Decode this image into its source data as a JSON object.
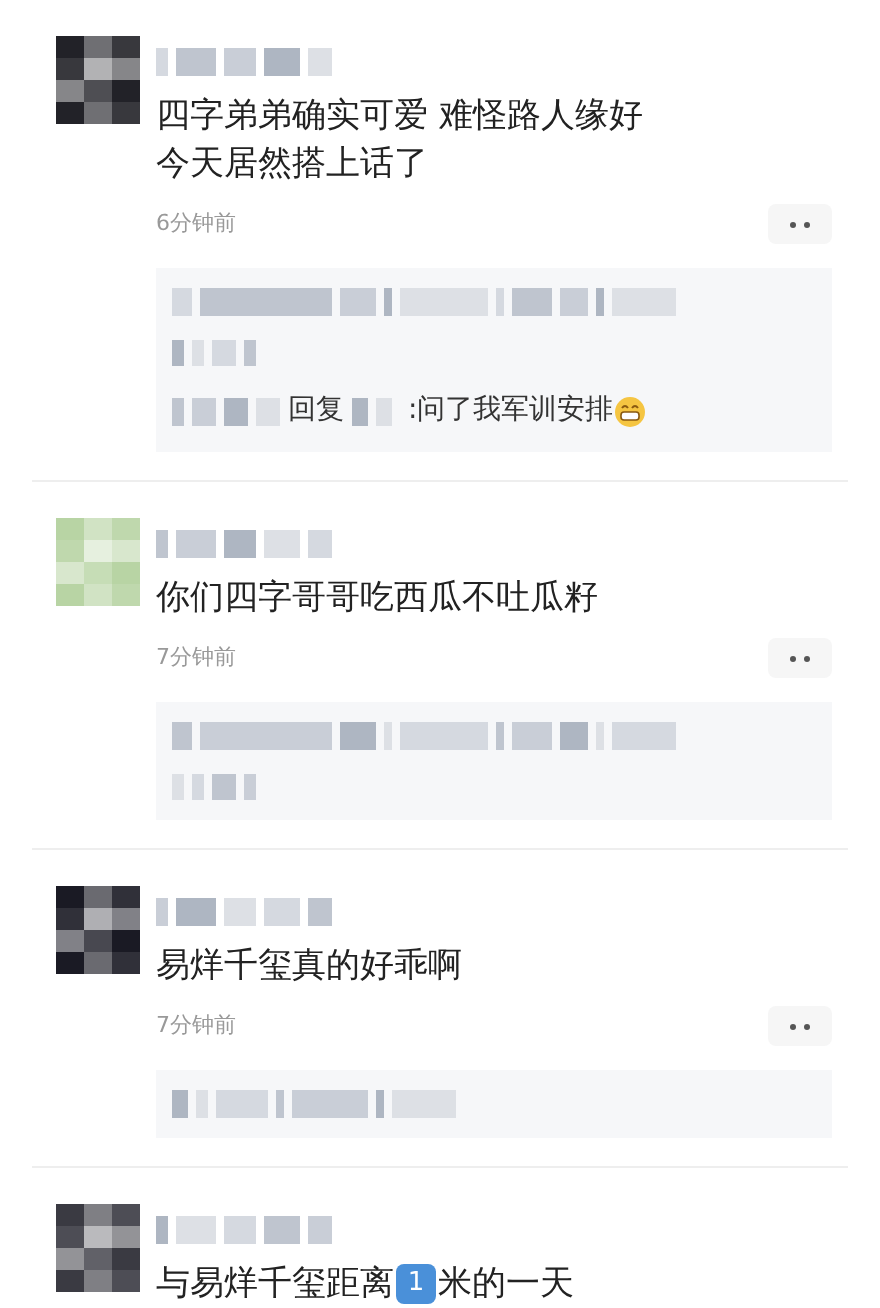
{
  "comments": [
    {
      "avatar": {
        "kind": "picture",
        "color": "#222228"
      },
      "text_lines": [
        "四字弟弟确实可爱 难怪路人缘好",
        "今天居然搭上话了"
      ],
      "time": "6分钟前",
      "replies": [
        {
          "kind": "blurred"
        },
        {
          "kind": "blurred-short"
        },
        {
          "kind": "reply",
          "verb": "回复",
          "text": ":问了我军训安排"
        }
      ]
    },
    {
      "avatar": {
        "kind": "picture",
        "color": "#b8d4a4"
      },
      "text_lines": [
        "你们四字哥哥吃西瓜不吐瓜籽"
      ],
      "time": "7分钟前",
      "replies": [
        {
          "kind": "blurred"
        },
        {
          "kind": "blurred-short"
        }
      ]
    },
    {
      "avatar": {
        "kind": "picture",
        "color": "#1a1a24"
      },
      "text_lines": [
        "易烊千玺真的好乖啊"
      ],
      "time": "7分钟前",
      "replies": [
        {
          "kind": "blurred-mid"
        }
      ]
    },
    {
      "avatar": {
        "kind": "picture",
        "color": "#3a3a42"
      },
      "text_parts": {
        "before": "与易烊千玺距离",
        "keycap": "1",
        "after": "米的一天"
      }
    }
  ]
}
